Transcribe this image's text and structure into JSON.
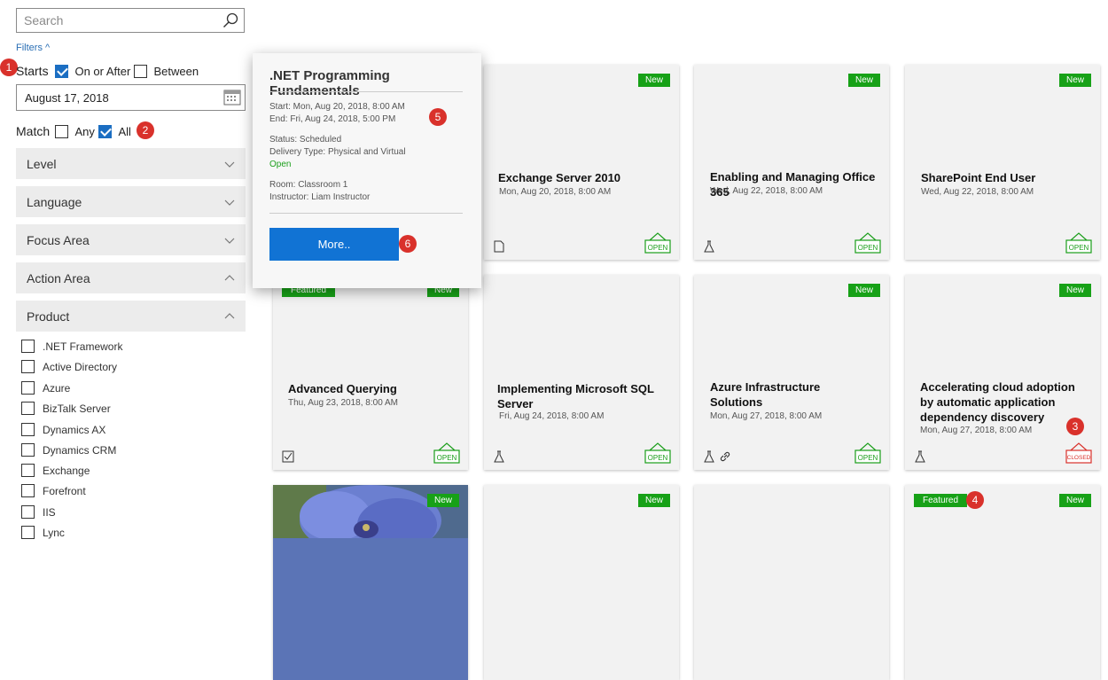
{
  "search": {
    "placeholder": "Search"
  },
  "filters": {
    "toggle_label": "Filters ^"
  },
  "starts": {
    "label": "Starts",
    "on_or_after": "On or After",
    "between": "Between",
    "date": "August 17, 2018"
  },
  "match": {
    "label": "Match",
    "any": "Any",
    "all": "All"
  },
  "accordions": {
    "level": "Level",
    "language": "Language",
    "focus_area": "Focus Area",
    "action_area": "Action Area",
    "product": "Product"
  },
  "products": [
    ".NET Framework",
    "Active Directory",
    "Azure",
    "BizTalk Server",
    "Dynamics AX",
    "Dynamics CRM",
    "Exchange",
    "Forefront",
    "IIS",
    "Lync"
  ],
  "badges": [
    "1",
    "2",
    "3",
    "4",
    "5",
    "6"
  ],
  "tags": {
    "new": "New",
    "featured": "Featured"
  },
  "status": {
    "open": "OPEN",
    "closed": "CLOSED"
  },
  "cards": [
    {
      "title": "Exchange Server 2010",
      "date": "Mon, Aug 20, 2018, 8:00 AM"
    },
    {
      "title": "Enabling and Managing Office 365",
      "date": "Wed, Aug 22, 2018, 8:00 AM"
    },
    {
      "title": "SharePoint End User",
      "date": "Wed, Aug 22, 2018, 8:00 AM"
    },
    {
      "title": "Advanced Querying",
      "date": "Thu, Aug 23, 2018, 8:00 AM"
    },
    {
      "title": "Implementing Microsoft SQL Server",
      "date": "Fri, Aug 24, 2018, 8:00 AM"
    },
    {
      "title": "Azure Infrastructure Solutions",
      "date": "Mon, Aug 27, 2018, 8:00 AM"
    },
    {
      "title": "Accelerating cloud adoption by automatic application dependency discovery",
      "date": "Mon, Aug 27, 2018, 8:00 AM"
    }
  ],
  "popup": {
    "title": ".NET Programming Fundamentals",
    "start": "Start: Mon, Aug 20, 2018, 8:00 AM",
    "end": "End: Fri, Aug 24, 2018, 5:00 PM",
    "status": "Status: Scheduled",
    "delivery": "Delivery Type: Physical and Virtual",
    "open": "Open",
    "room": "Room: Classroom 1",
    "instructor": "Instructor: Liam Instructor",
    "more": "More.."
  },
  "colors": {
    "accent": "#1173d4",
    "green": "#17a117",
    "closed": "#d9312b",
    "badge": "#d9312b"
  },
  "icons": [
    "search-icon",
    "calendar-icon",
    "chevron-down-icon",
    "chevron-up-icon",
    "document-icon",
    "lab-flask-icon",
    "link-icon",
    "checkbox-icon",
    "open-sign-icon",
    "closed-sign-icon"
  ]
}
